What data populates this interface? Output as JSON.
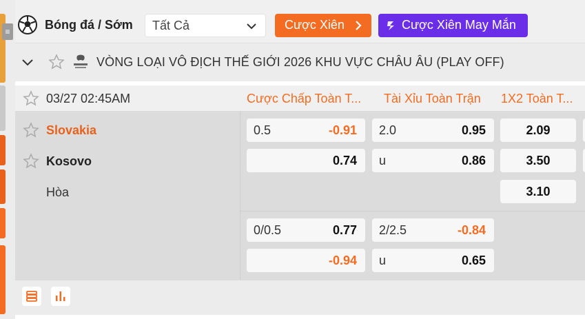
{
  "header": {
    "sport_title": "Bóng đá / Sớm",
    "filter_value": "Tất Cả",
    "parlay_button": "Cược Xiên",
    "lucky_parlay_button": "Cược Xiên May Mắn"
  },
  "league": {
    "title": "VÒNG LOẠI VÔ ĐỊCH THẾ GIỚI 2026 KHU VỰC CHÂU ÂU (PLAY OFF)"
  },
  "match": {
    "datetime": "03/27 02:45AM",
    "columns": {
      "handicap": "Cược Chấp Toàn T...",
      "over_under": "Tài Xỉu Toàn Trận",
      "one_x_two": "1X2 Toàn T..."
    },
    "home": "Slovakia",
    "away": "Kosovo",
    "draw": "Hòa",
    "lines": [
      {
        "hdp_home_line": "0.5",
        "hdp_home_odds": "-0.91",
        "hdp_away_line": "",
        "hdp_away_odds": "0.74",
        "ou_over_line": "2.0",
        "ou_over_odds": "0.95",
        "ou_under_line": "u",
        "ou_under_odds": "0.86",
        "x12_home": "2.09",
        "x12_away": "3.50",
        "x12_draw": "3.10"
      },
      {
        "hdp_home_line": "0/0.5",
        "hdp_home_odds": "0.77",
        "hdp_away_line": "",
        "hdp_away_odds": "-0.94",
        "ou_over_line": "2/2.5",
        "ou_over_odds": "-0.84",
        "ou_under_line": "u",
        "ou_under_odds": "0.65"
      }
    ]
  },
  "colors": {
    "accent_orange": "#f36c21",
    "accent_purple": "#6a2ee8",
    "home_team": "#e8621c"
  },
  "icons": {
    "sport": "soccer-ball-icon",
    "expand": "chevron-down-icon",
    "favorite": "star-icon",
    "league_logo": "european-qualifiers-logo",
    "bet_list": "list-icon",
    "stats": "bar-chart-icon"
  }
}
